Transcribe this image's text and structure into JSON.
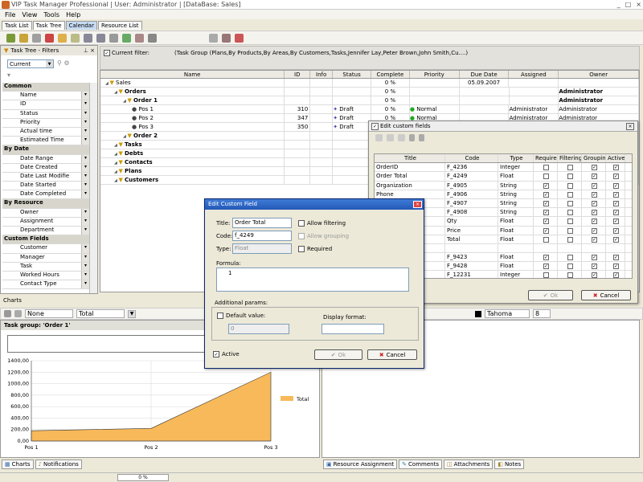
{
  "window": {
    "title": "VIP Task Manager Professional | User: Administrator | [DataBase: Sales]",
    "controls": [
      "_",
      "□",
      "×"
    ]
  },
  "menu": [
    "File",
    "View",
    "Tools",
    "Help"
  ],
  "view_tabs": [
    {
      "label": "Task List",
      "selected": false
    },
    {
      "label": "Task Tree",
      "selected": true
    },
    {
      "label": "Calendar",
      "selected": false
    },
    {
      "label": "Resource List",
      "selected": false
    }
  ],
  "left_panel": {
    "title": "Task Tree - Filters",
    "filter_select": "Current",
    "property_rows": [
      {
        "label": "Common",
        "cat": true
      },
      {
        "label": "Name"
      },
      {
        "label": "ID"
      },
      {
        "label": "Status"
      },
      {
        "label": "Priority"
      },
      {
        "label": "Actual time"
      },
      {
        "label": "Estimated Time"
      },
      {
        "label": "By Date",
        "cat": true
      },
      {
        "label": "Date Range"
      },
      {
        "label": "Date Created"
      },
      {
        "label": "Date Last Modifie"
      },
      {
        "label": "Date Started"
      },
      {
        "label": "Date Completed"
      },
      {
        "label": "By Resource",
        "cat": true
      },
      {
        "label": "Owner"
      },
      {
        "label": "Assignment"
      },
      {
        "label": "Department"
      },
      {
        "label": "Custom Fields",
        "cat": true
      },
      {
        "label": "Customer"
      },
      {
        "label": "Manager"
      },
      {
        "label": "Task"
      },
      {
        "label": "Worked Hours"
      },
      {
        "label": "Contact Type"
      }
    ]
  },
  "filter": {
    "label": "Current filter:",
    "text": "(Task Group  (Plans,By Products,By Areas,By Customers,Tasks,Jennifer Lay,Peter Brown,John Smith,Cu....)"
  },
  "grid": {
    "columns": [
      "Name",
      "ID",
      "Info",
      "Status",
      "Complete",
      "Priority",
      "Due Date",
      "Assigned",
      "Owner"
    ],
    "rows": [
      {
        "name": "Sales",
        "id": "",
        "status": "",
        "complete": "0 %",
        "priority": "",
        "due": "05.09.2007",
        "assigned": "",
        "owner": "",
        "bold": false,
        "indent": 0
      },
      {
        "name": "Orders",
        "id": "",
        "status": "",
        "complete": "0 %",
        "priority": "",
        "due": "",
        "assigned": "",
        "owner": "Administrator",
        "bold": true,
        "indent": 1
      },
      {
        "name": "Order 1",
        "id": "",
        "status": "",
        "complete": "0 %",
        "priority": "",
        "due": "",
        "assigned": "",
        "owner": "Administrator",
        "bold": true,
        "indent": 2
      },
      {
        "name": "Pos 1",
        "id": "310",
        "status": "Draft",
        "complete": "0 %",
        "priority": "Normal",
        "due": "",
        "assigned": "Administrator",
        "owner": "Administrator",
        "bold": false,
        "indent": 3
      },
      {
        "name": "Pos 2",
        "id": "347",
        "status": "Draft",
        "complete": "0 %",
        "priority": "Normal",
        "due": "",
        "assigned": "Administrator",
        "owner": "Administrator",
        "bold": false,
        "indent": 3
      },
      {
        "name": "Pos 3",
        "id": "350",
        "status": "Draft",
        "complete": "",
        "priority": "",
        "due": "",
        "assigned": "",
        "owner": "",
        "bold": false,
        "indent": 3
      },
      {
        "name": "Order 2",
        "id": "",
        "status": "",
        "complete": "",
        "priority": "",
        "due": "",
        "assigned": "",
        "owner": "",
        "bold": true,
        "indent": 2
      },
      {
        "name": "Tasks",
        "id": "",
        "status": "",
        "complete": "",
        "priority": "",
        "due": "",
        "assigned": "",
        "owner": "",
        "bold": true,
        "indent": 1
      },
      {
        "name": "Debts",
        "id": "",
        "status": "",
        "complete": "",
        "priority": "",
        "due": "",
        "assigned": "",
        "owner": "",
        "bold": true,
        "indent": 1
      },
      {
        "name": "Contacts",
        "id": "",
        "status": "",
        "complete": "",
        "priority": "",
        "due": "",
        "assigned": "",
        "owner": "",
        "bold": true,
        "indent": 1
      },
      {
        "name": "Plans",
        "id": "",
        "status": "",
        "complete": "",
        "priority": "",
        "due": "",
        "assigned": "",
        "owner": "",
        "bold": true,
        "indent": 1
      },
      {
        "name": "Customers",
        "id": "",
        "status": "",
        "complete": "",
        "priority": "",
        "due": "",
        "assigned": "",
        "owner": "",
        "bold": true,
        "indent": 1
      }
    ]
  },
  "custom_fields_dialog": {
    "title": "Edit custom fields",
    "columns": [
      "Title",
      "Code",
      "Type",
      "Required",
      "Filtering",
      "Grouping",
      "Active"
    ],
    "rows": [
      {
        "title": "OrderID",
        "code": "F_4236",
        "type": "Integer",
        "req": false,
        "filt": false,
        "grp": true,
        "act": true
      },
      {
        "title": "Order Total",
        "code": "F_4249",
        "type": "Float",
        "req": false,
        "filt": false,
        "grp": true,
        "act": true
      },
      {
        "title": "Organization",
        "code": "F_4905",
        "type": "String",
        "req": true,
        "filt": false,
        "grp": true,
        "act": true
      },
      {
        "title": "Phone",
        "code": "F_4906",
        "type": "String",
        "req": true,
        "filt": false,
        "grp": true,
        "act": true
      },
      {
        "title": "",
        "code": "F_4907",
        "type": "String",
        "req": true,
        "filt": false,
        "grp": true,
        "act": true
      },
      {
        "title": "",
        "code": "F_4908",
        "type": "String",
        "req": true,
        "filt": false,
        "grp": true,
        "act": true
      },
      {
        "title": "",
        "code": "Qty",
        "type": "Float",
        "req": true,
        "filt": false,
        "grp": true,
        "act": true
      },
      {
        "title": "",
        "code": "Price",
        "type": "Float",
        "req": true,
        "filt": false,
        "grp": true,
        "act": true
      },
      {
        "title": "",
        "code": "Total",
        "type": "Float",
        "req": false,
        "filt": false,
        "grp": true,
        "act": true
      },
      {
        "title": "",
        "code": "",
        "type": "",
        "req": false,
        "filt": false,
        "grp": false,
        "act": false
      },
      {
        "title": "",
        "code": "F_9423",
        "type": "Float",
        "req": true,
        "filt": false,
        "grp": true,
        "act": true
      },
      {
        "title": "",
        "code": "F_9428",
        "type": "Float",
        "req": true,
        "filt": false,
        "grp": true,
        "act": true
      },
      {
        "title": "",
        "code": "F_12231",
        "type": "Integer",
        "req": false,
        "filt": false,
        "grp": true,
        "act": true
      }
    ],
    "ok": "Ok",
    "cancel": "Cancel"
  },
  "edit_field_dialog": {
    "title": "Edit Custom Field",
    "title_label": "Title:",
    "title_value": "Order Total",
    "code_label": "Code:",
    "code_value": "f_4249",
    "type_label": "Type:",
    "type_value": "Float",
    "allow_filtering": "Allow filtering",
    "allow_grouping": "Allow grouping",
    "required": "Required",
    "formula_label": "Formula:",
    "formula_line": "1",
    "additional_label": "Additional params:",
    "default_label": "Default value:",
    "default_value": "0",
    "display_format_label": "Display format:",
    "active_label": "Active",
    "active_checked": true,
    "ok": "Ok",
    "cancel": "Cancel"
  },
  "charts": {
    "section_label": "Charts",
    "select1": "None",
    "select2": "Total",
    "task_group": "Task group: 'Order 1'",
    "tabs": [
      "Charts",
      "Notifications"
    ]
  },
  "chart_data": {
    "type": "area",
    "categories": [
      "Pos 1",
      "Pos 2",
      "Pos 3"
    ],
    "series": [
      {
        "name": "Total",
        "values": [
          180,
          220,
          1200
        ],
        "color": "#f8b95a"
      }
    ],
    "ylim": [
      0,
      1400
    ],
    "yticks": [
      "0,00",
      "200,00",
      "400,00",
      "600,00",
      "800,00",
      "1000,00",
      "1200,00",
      "1400,00"
    ],
    "legend": "right"
  },
  "format_bar": {
    "font": "Tahoma",
    "size": "8"
  },
  "bottom_tabs": [
    "Resource Assignment",
    "Comments",
    "Attachments",
    "Notes"
  ],
  "status_bar": {
    "progress": "0 %"
  }
}
